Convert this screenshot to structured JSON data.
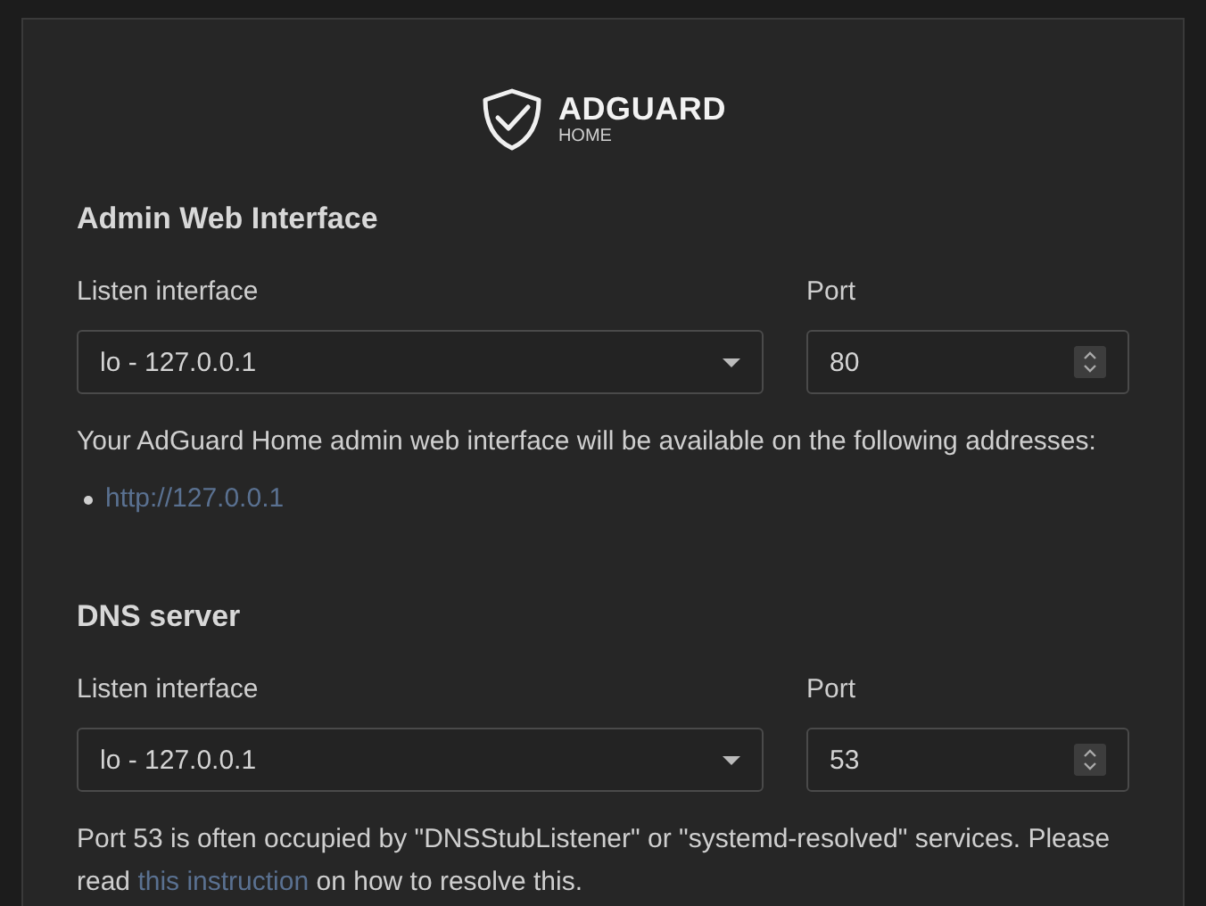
{
  "logo": {
    "name": "ADGUARD",
    "subtitle": "HOME"
  },
  "sections": [
    {
      "title": "Admin Web Interface",
      "interface_label": "Listen interface",
      "interface_value": "lo - 127.0.0.1",
      "port_label": "Port",
      "port_value": "80",
      "note": {
        "before": "Your AdGuard Home admin web interface will be available on the following addresses:"
      },
      "addresses": [
        "http://127.0.0.1"
      ]
    },
    {
      "title": "DNS server",
      "interface_label": "Listen interface",
      "interface_value": "lo - 127.0.0.1",
      "port_label": "Port",
      "port_value": "53",
      "note": {
        "before": "Port 53 is often occupied by \"DNSStubListener\" or \"systemd-resolved\" services. Please read ",
        "link": "this instruction",
        "after": " on how to resolve this."
      }
    }
  ]
}
